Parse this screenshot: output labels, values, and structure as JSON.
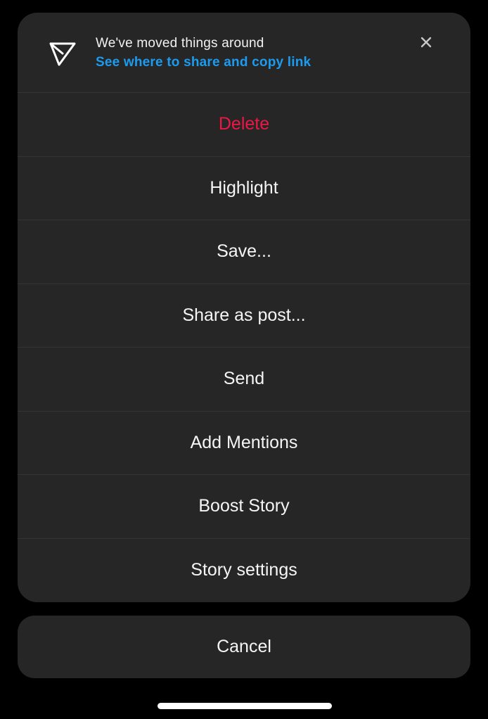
{
  "banner": {
    "icon": "paper-plane-icon",
    "title": "We've moved things around",
    "link": "See where to share and copy link",
    "close_icon": "close-icon"
  },
  "menu": {
    "items": [
      {
        "label": "Delete",
        "style": "danger"
      },
      {
        "label": "Highlight"
      },
      {
        "label": "Save..."
      },
      {
        "label": "Share as post..."
      },
      {
        "label": "Send"
      },
      {
        "label": "Add Mentions"
      },
      {
        "label": "Boost Story"
      },
      {
        "label": "Story settings"
      }
    ]
  },
  "cancel": {
    "label": "Cancel"
  },
  "colors": {
    "background": "#000000",
    "sheet": "#262626",
    "danger": "#ed1746",
    "link": "#1c9bf0",
    "text": "#f5f5f5"
  }
}
